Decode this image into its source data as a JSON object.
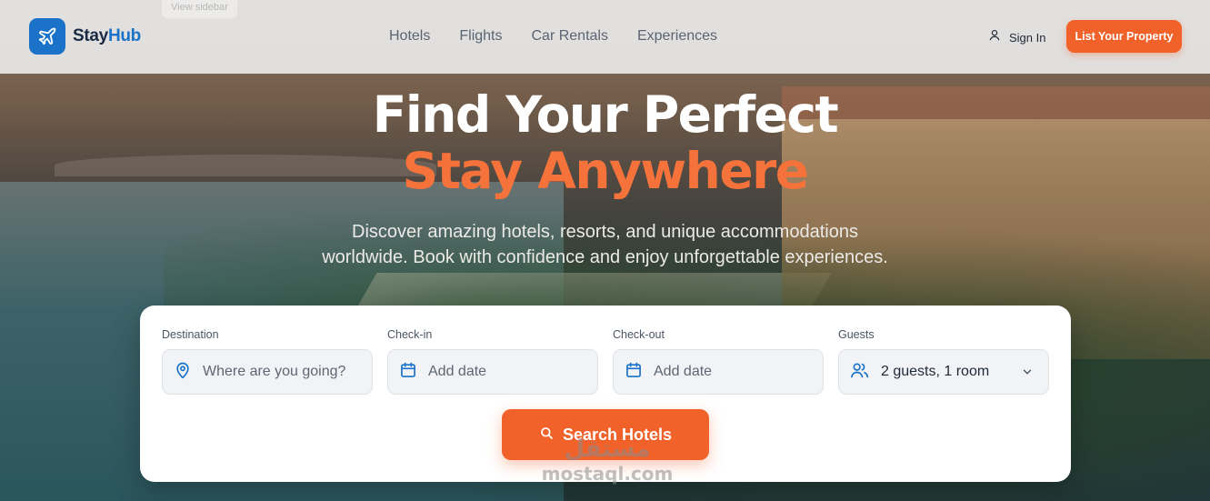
{
  "ghost_tag": "View sidebar",
  "brand": {
    "name_part1": "Stay",
    "name_part2": "Hub",
    "icon": "airplane-icon",
    "color": "#1a73c8"
  },
  "nav": {
    "items": [
      {
        "label": "Hotels"
      },
      {
        "label": "Flights"
      },
      {
        "label": "Car Rentals"
      },
      {
        "label": "Experiences"
      }
    ]
  },
  "header_actions": {
    "sign_in": {
      "label": "Sign In",
      "icon": "user-icon"
    },
    "list_property": {
      "label": "List Your Property"
    }
  },
  "hero": {
    "title_line1": "Find Your Perfect",
    "title_line2": "Stay Anywhere",
    "subtitle_line1": "Discover amazing hotels, resorts, and unique accommodations",
    "subtitle_line2": "worldwide. Book with confidence and enjoy unforgettable experiences."
  },
  "search": {
    "destination": {
      "label": "Destination",
      "placeholder": "Where are you going?",
      "icon": "map-pin-icon"
    },
    "check_in": {
      "label": "Check-in",
      "placeholder": "Add date",
      "icon": "calendar-icon"
    },
    "check_out": {
      "label": "Check-out",
      "placeholder": "Add date",
      "icon": "calendar-icon"
    },
    "guests": {
      "label": "Guests",
      "value": "2 guests, 1 room",
      "icon": "users-icon"
    },
    "button_label": "Search Hotels"
  },
  "watermark": {
    "arabic": "مستقل",
    "latin": "mostaql.com"
  },
  "colors": {
    "accent": "#f0622a",
    "brand": "#1a73c8",
    "headline_accent": "#f5733b"
  }
}
